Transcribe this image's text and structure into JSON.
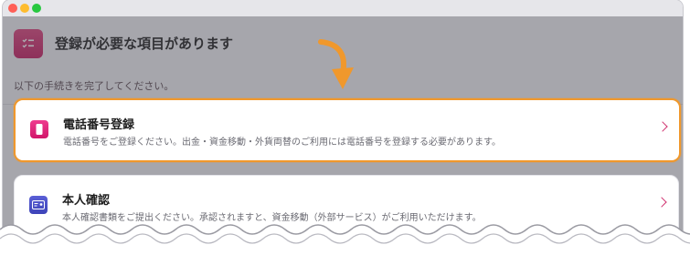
{
  "window": {
    "traffic_lights": [
      "#ff5f57",
      "#febc2e",
      "#28c840"
    ]
  },
  "header": {
    "icon": "checklist-icon",
    "title": "登録が必要な項目があります",
    "subtitle": "以下の手続きを完了してください。"
  },
  "items": [
    {
      "icon": "phone-icon",
      "title": "電話番号登録",
      "description": "電話番号をご登録ください。出金・資金移動・外貨両替のご利用には電話番号を登録する必要があります。",
      "highlighted": true
    },
    {
      "icon": "id-card-icon",
      "title": "本人確認",
      "description": "本人確認書類をご提出ください。承認されますと、資金移動（外部サービス）がご利用いただけます。",
      "highlighted": false
    }
  ],
  "colors": {
    "accent": "#d0326f",
    "highlight_border": "#f0982c",
    "pointer": "#f0982c"
  }
}
